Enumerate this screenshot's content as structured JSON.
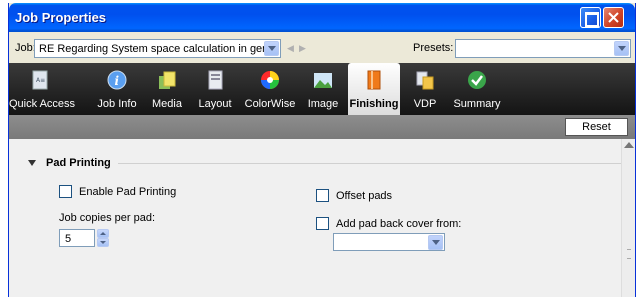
{
  "window": {
    "title": "Job Properties",
    "colors": {
      "titlebar": "#0054e3",
      "toolbar": "#1e1e1e",
      "accent": "#0831d9"
    }
  },
  "job_row": {
    "job_label": "Job:",
    "job_value": "RE Regarding System space calculation in genera",
    "presets_label": "Presets:",
    "presets_value": "",
    "prev_icon": "nav-left-icon",
    "next_icon": "nav-right-icon"
  },
  "toolbar": {
    "tabs": [
      {
        "label": "Quick Access",
        "icon": "quick-access-icon",
        "active": false
      },
      {
        "label": "Job Info",
        "icon": "info-icon",
        "active": false
      },
      {
        "label": "Media",
        "icon": "media-icon",
        "active": false
      },
      {
        "label": "Layout",
        "icon": "layout-icon",
        "active": false
      },
      {
        "label": "ColorWise",
        "icon": "color-wheel-icon",
        "active": false
      },
      {
        "label": "Image",
        "icon": "image-icon",
        "active": false
      },
      {
        "label": "Finishing",
        "icon": "finishing-icon",
        "active": true
      },
      {
        "label": "VDP",
        "icon": "vdp-icon",
        "active": false
      },
      {
        "label": "Summary",
        "icon": "summary-check-icon",
        "active": false
      }
    ]
  },
  "actions": {
    "reset_label": "Reset"
  },
  "pad_printing": {
    "section_title": "Pad Printing",
    "enable_label": "Enable Pad Printing",
    "enable_checked": false,
    "copies_label": "Job copies per pad:",
    "copies_value": "5",
    "offset_label": "Offset pads",
    "offset_checked": false,
    "back_cover_label": "Add pad back cover from:",
    "back_cover_checked": false,
    "back_cover_value": ""
  }
}
